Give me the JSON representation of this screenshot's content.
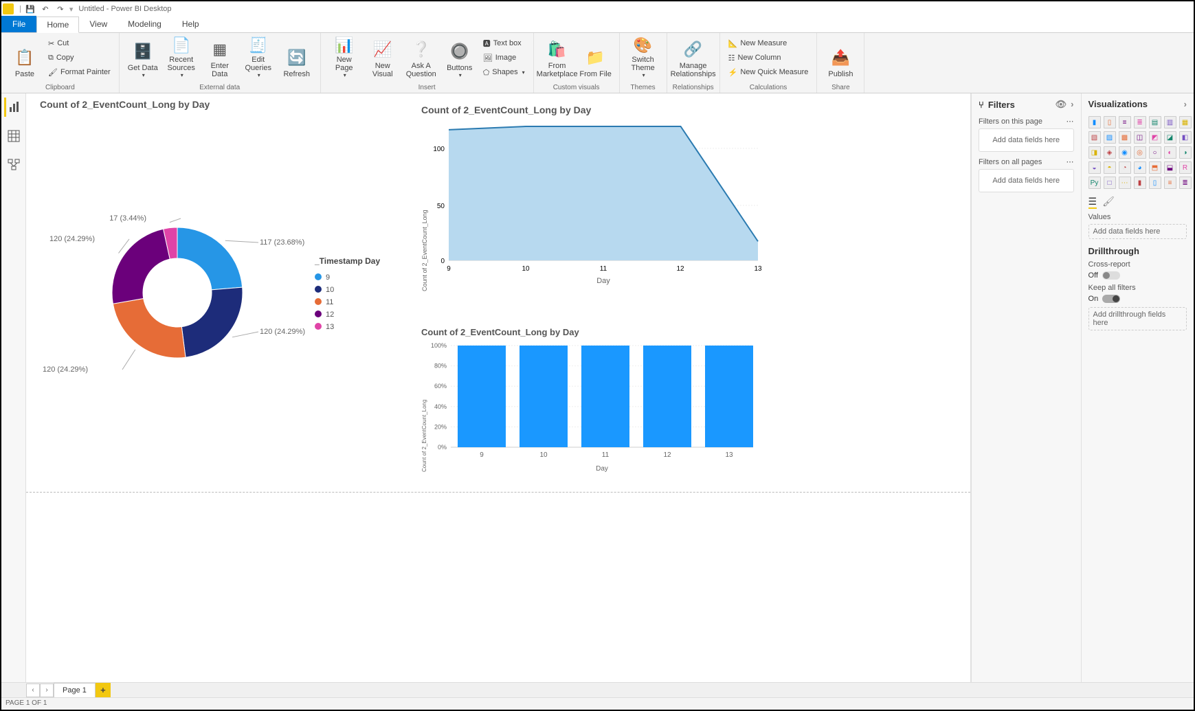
{
  "titlebar": {
    "title": "Untitled - Power BI Desktop"
  },
  "tabs": {
    "file": "File",
    "home": "Home",
    "view": "View",
    "modeling": "Modeling",
    "help": "Help"
  },
  "ribbon": {
    "clipboard": {
      "label": "Clipboard",
      "paste": "Paste",
      "cut": "Cut",
      "copy": "Copy",
      "format_painter": "Format Painter"
    },
    "external": {
      "label": "External data",
      "get_data": "Get Data",
      "recent_sources": "Recent Sources",
      "enter_data": "Enter Data",
      "edit_queries": "Edit Queries",
      "refresh": "Refresh"
    },
    "insert": {
      "label": "Insert",
      "new_page": "New Page",
      "new_visual": "New Visual",
      "ask_q": "Ask A Question",
      "buttons": "Buttons",
      "text_box": "Text box",
      "image": "Image",
      "shapes": "Shapes"
    },
    "custom": {
      "label": "Custom visuals",
      "marketplace": "From Marketplace",
      "file": "From File"
    },
    "themes": {
      "label": "Themes",
      "switch": "Switch Theme"
    },
    "rel": {
      "label": "Relationships",
      "manage": "Manage Relationships"
    },
    "calc": {
      "label": "Calculations",
      "new_measure": "New Measure",
      "new_column": "New Column",
      "new_quick": "New Quick Measure"
    },
    "share": {
      "label": "Share",
      "publish": "Publish"
    }
  },
  "filters_pane": {
    "header": "Filters",
    "this_page": "Filters on this page",
    "add": "Add data fields here",
    "all_pages": "Filters on all pages"
  },
  "viz_pane": {
    "header": "Visualizations",
    "values": "Values",
    "add": "Add data fields here",
    "drillthrough": "Drillthrough",
    "cross_report": "Cross-report",
    "off": "Off",
    "keep_all": "Keep all filters",
    "on": "On",
    "add_drill": "Add drillthrough fields here"
  },
  "bottom": {
    "page1": "Page 1"
  },
  "statusbar": {
    "text": "PAGE 1 OF 1"
  },
  "visual1_title": "Count of 2_EventCount_Long by Day",
  "visual2_title": "Count of 2_EventCount_Long by Day",
  "visual3_title": "Count of 2_EventCount_Long by Day",
  "legend_title": "_Timestamp Day",
  "donut_labels": {
    "d9": "117 (23.68%)",
    "d10": "120 (24.29%)",
    "d11": "120 (24.29%)",
    "d12": "120 (24.29%)",
    "d13": "17 (3.44%)"
  },
  "legend_items": {
    "i9": "9",
    "i10": "10",
    "i11": "11",
    "i12": "12",
    "i13": "13"
  },
  "area_ylabel": "Count of 2_EventCount_Long",
  "area_xlabel": "Day",
  "area_yticks": {
    "t0": "0",
    "t50": "50",
    "t100": "100"
  },
  "area_xticks": {
    "x9": "9",
    "x10": "10",
    "x11": "11",
    "x12": "12",
    "x13": "13"
  },
  "bar_ylabel": "Count of 2_EventCount_Long",
  "bar_xlabel": "Day",
  "bar_yticks": {
    "t0": "0%",
    "t20": "20%",
    "t40": "40%",
    "t60": "60%",
    "t80": "80%",
    "t100": "100%"
  },
  "bar_xticks": {
    "x9": "9",
    "x10": "10",
    "x11": "11",
    "x12": "12",
    "x13": "13"
  },
  "colors": {
    "c9": "#2696e6",
    "c10": "#1d2c7a",
    "c11": "#e66c37",
    "c12": "#6b007b",
    "c13": "#e044a7",
    "area_fill": "#b7d9ef",
    "area_stroke": "#2a7ab0",
    "bar_fill": "#1a98ff"
  },
  "chart_data": [
    {
      "type": "pie",
      "title": "Count of 2_EventCount_Long by Day",
      "legend_title": "_Timestamp Day",
      "categories": [
        "9",
        "10",
        "11",
        "12",
        "13"
      ],
      "values": [
        117,
        120,
        120,
        120,
        17
      ],
      "percentages": [
        23.68,
        24.29,
        24.29,
        24.29,
        3.44
      ],
      "colors": [
        "#2696e6",
        "#1d2c7a",
        "#e66c37",
        "#6b007b",
        "#e044a7"
      ]
    },
    {
      "type": "area",
      "title": "Count of 2_EventCount_Long by Day",
      "xlabel": "Day",
      "ylabel": "Count of 2_EventCount_Long",
      "x": [
        9,
        10,
        11,
        12,
        13
      ],
      "y": [
        117,
        120,
        120,
        120,
        17
      ],
      "ylim": [
        0,
        120
      ]
    },
    {
      "type": "bar",
      "title": "Count of 2_EventCount_Long by Day",
      "xlabel": "Day",
      "ylabel": "Count of 2_EventCount_Long",
      "categories": [
        "9",
        "10",
        "11",
        "12",
        "13"
      ],
      "values": [
        100,
        100,
        100,
        100,
        100
      ],
      "unit": "%",
      "ylim": [
        0,
        100
      ]
    }
  ]
}
